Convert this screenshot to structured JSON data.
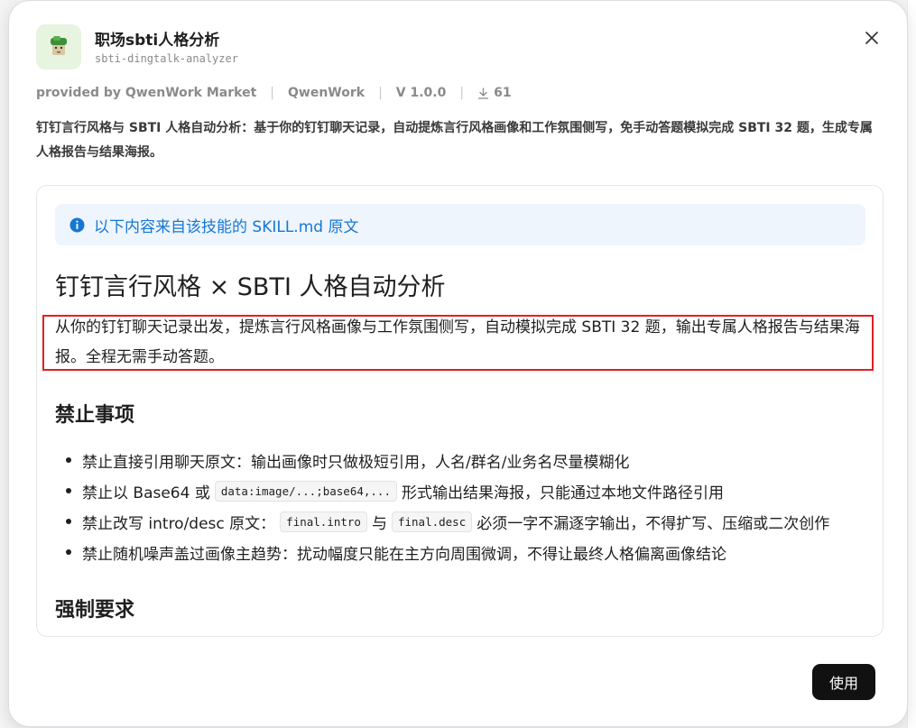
{
  "dialog": {
    "title": "职场sbti人格分析",
    "slug": "sbti-dingtalk-analyzer"
  },
  "meta": {
    "provider": "provided by QwenWork Market",
    "author": "QwenWork",
    "version": "V 1.0.0",
    "downloads": "61"
  },
  "description": "钉钉言行风格与 SBTI 人格自动分析：基于你的钉钉聊天记录，自动提炼言行风格画像和工作氛围侧写，免手动答题模拟完成 SBTI 32 题，生成专属人格报告与结果海报。",
  "doc": {
    "notice": "以下内容来自该技能的 SKILL.md 原文",
    "heading": "钉钉言行风格 × SBTI 人格自动分析",
    "intro": "从你的钉钉聊天记录出发，提炼言行风格画像与工作氛围侧写，自动模拟完成 SBTI 32 题，输出专属人格报告与结果海报。全程无需手动答题。",
    "section1_title": "禁止事项",
    "rules": [
      {
        "parts": [
          "禁止直接引用聊天原文：输出画像时只做极短引用，人名/群名/业务名尽量模糊化"
        ]
      },
      {
        "parts": [
          "禁止以 Base64 或",
          "data:image/...;base64,...",
          "形式输出结果海报，只能通过本地文件路径引用"
        ]
      },
      {
        "parts": [
          "禁止改写 intro/desc 原文：",
          "final.intro",
          "与",
          "final.desc",
          "必须一字不漏逐字输出，不得扩写、压缩或二次创作"
        ]
      },
      {
        "parts": [
          "禁止随机噪声盖过画像主趋势：扰动幅度只能在主方向周围微调，不得让最终人格偏离画像结论"
        ]
      }
    ],
    "section2_title": "强制要求"
  },
  "actions": {
    "use_label": "使用"
  },
  "colors": {
    "accent_blue": "#1677d2",
    "highlight_red": "#e02020",
    "button_dark": "#111111"
  },
  "icons": {
    "close": "close-icon",
    "info": "info-icon",
    "download": "download-icon",
    "app": "app-avatar-icon"
  }
}
